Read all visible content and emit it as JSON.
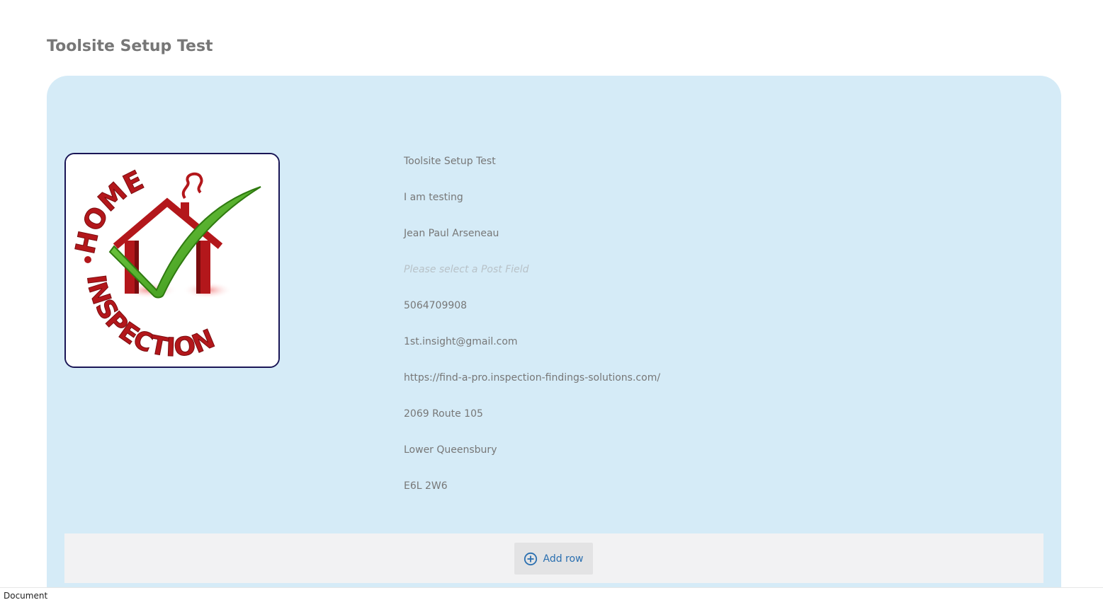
{
  "page": {
    "title": "Toolsite Setup Test"
  },
  "logo": {
    "icon": "home-inspection-logo",
    "top_text": "HOME",
    "bottom_text": "INSPECTION",
    "colors": {
      "red": "#b3171b",
      "green": "#52b81f",
      "border": "#1a1656"
    }
  },
  "fields": [
    {
      "name": "business-name",
      "value": "Toolsite Setup Test",
      "placeholder": false
    },
    {
      "name": "description",
      "value": "I am testing",
      "placeholder": false
    },
    {
      "name": "contact-name",
      "value": "Jean Paul Arseneau",
      "placeholder": false
    },
    {
      "name": "post-field",
      "value": "Please select a Post Field",
      "placeholder": true
    },
    {
      "name": "phone",
      "value": "5064709908",
      "placeholder": false
    },
    {
      "name": "email",
      "value": "1st.insight@gmail.com",
      "placeholder": false
    },
    {
      "name": "website",
      "value": "https://find-a-pro.inspection-findings-solutions.com/",
      "placeholder": false
    },
    {
      "name": "street-address",
      "value": "2069 Route 105",
      "placeholder": false
    },
    {
      "name": "city",
      "value": "Lower Queensbury",
      "placeholder": false
    },
    {
      "name": "postal-code",
      "value": "E6L 2W6",
      "placeholder": false
    }
  ],
  "add_row": {
    "label": "Add row",
    "icon": "plus-circle-icon"
  },
  "status_bar": {
    "text": "Document"
  },
  "colors": {
    "card_background": "#d5ebf7",
    "text": "#777777",
    "placeholder": "#b8c2c8",
    "link_blue": "#2a6fb0"
  }
}
